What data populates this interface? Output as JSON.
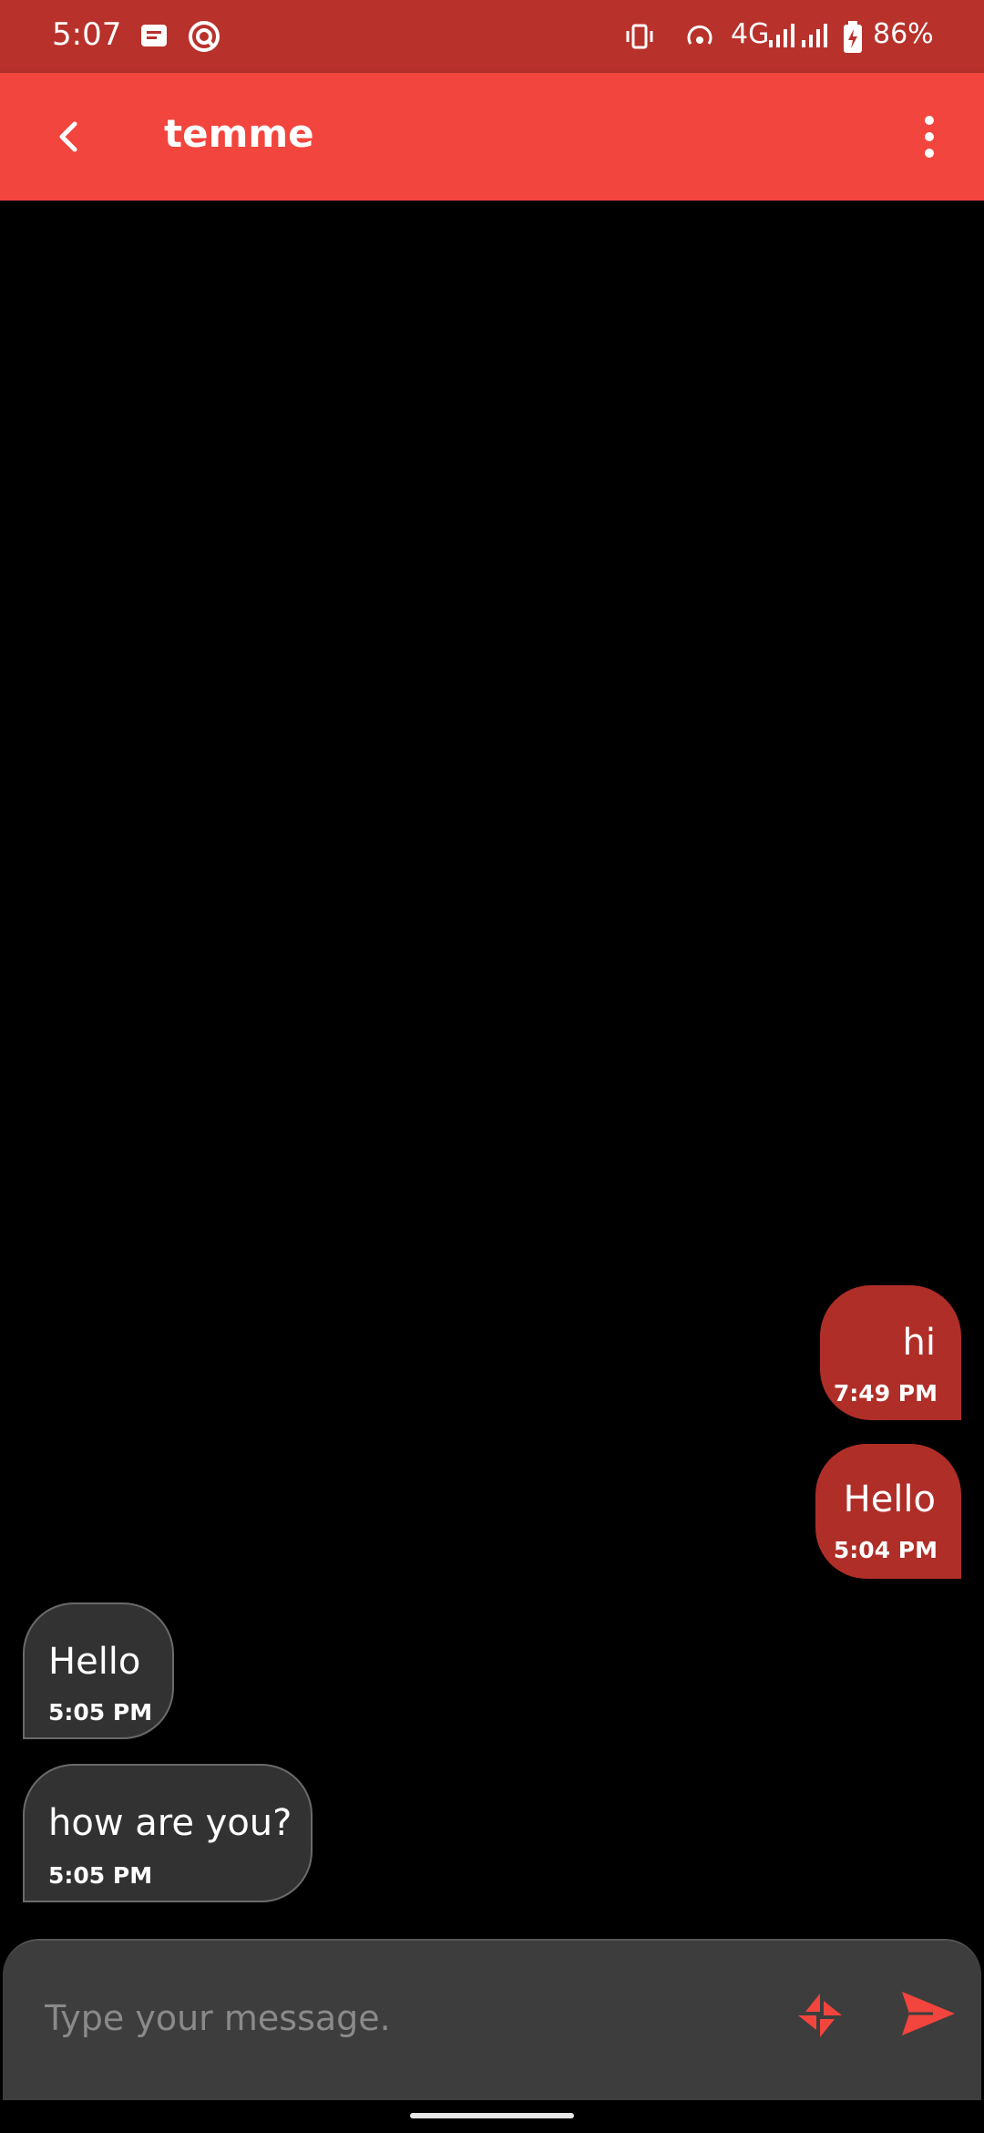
{
  "status_bar": {
    "time": "5:07",
    "network": "4G",
    "battery": "86%"
  },
  "header": {
    "title": "temme"
  },
  "messages": [
    {
      "direction": "sent",
      "text": "hi",
      "time": "7:49 PM"
    },
    {
      "direction": "sent",
      "text": "Hello",
      "time": "5:04 PM"
    },
    {
      "direction": "received",
      "text": "Hello",
      "time": "5:05 PM"
    },
    {
      "direction": "received",
      "text": "how are you?",
      "time": "5:05 PM"
    }
  ],
  "composer": {
    "placeholder": "Type your message."
  },
  "colors": {
    "status_bar": "#b8312b",
    "app_bar": "#f2453d",
    "sent_bubble": "#b02e28",
    "received_bubble": "#323232",
    "accent": "#f2453d"
  }
}
